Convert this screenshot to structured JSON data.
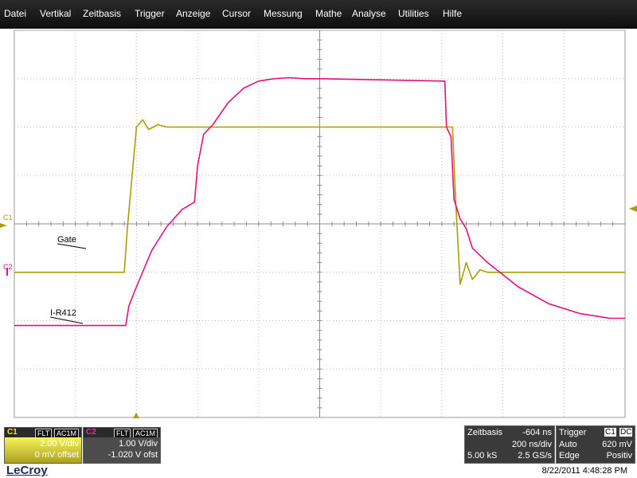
{
  "menu": [
    "Datei",
    "Vertikal",
    "Zeitbasis",
    "Trigger",
    "Anzeige",
    "Cursor",
    "Messung",
    "Mathe",
    "Analyse",
    "Utilities",
    "Hilfe"
  ],
  "colors": {
    "ch1": "#a8a000",
    "ch2": "#e60f7a",
    "grid": "#bfbfbf",
    "menubar": "#1a1a1a"
  },
  "plot": {
    "c1_marker": "C1",
    "c2_marker": "C2",
    "trace_labels": {
      "gate": "Gate",
      "current": "I-R412"
    }
  },
  "channels": {
    "c1": {
      "name": "C1",
      "coupling1": "FLT",
      "coupling2": "AC1M",
      "vdiv": "2.00 V/div",
      "offset": "0 mV offset"
    },
    "c2": {
      "name": "C2",
      "coupling1": "FLT",
      "coupling2": "AC1M",
      "vdiv": "1.00 V/div",
      "offset": "-1.020 V ofst"
    }
  },
  "timebase": {
    "label": "Zeitbasis",
    "delay": "-604 ns",
    "tdiv": "200 ns/div",
    "samples": "5.00 kS",
    "rate": "2.5 GS/s"
  },
  "trigger": {
    "label": "Trigger",
    "source": "C1",
    "coupling": "DC",
    "mode": "Auto",
    "level": "620 mV",
    "type": "Edge",
    "slope": "Positiv"
  },
  "brand": "LeCroy",
  "datetime": "8/22/2011 4:48:28 PM",
  "chart_data": {
    "type": "line",
    "series": [
      {
        "name": "Gate",
        "x": [
          -2.0,
          -1.28,
          -1.26,
          -1.2,
          -1.16,
          -1.12,
          -1.06,
          -1.0,
          0.0,
          0.87,
          0.89,
          0.92,
          0.96,
          1.0,
          1.05,
          1.1,
          1.25,
          1.5,
          2.0
        ],
        "y": [
          -1.0,
          -1.0,
          -0.1,
          2.0,
          2.15,
          1.95,
          2.05,
          2.0,
          2.0,
          2.0,
          0.5,
          -1.25,
          -0.8,
          -1.15,
          -0.95,
          -1.0,
          -1.0,
          -1.0,
          -1.0
        ]
      },
      {
        "name": "I-R412",
        "x": [
          -2.0,
          -1.27,
          -1.25,
          -1.2,
          -1.1,
          -1.0,
          -0.9,
          -0.82,
          -0.8,
          -0.76,
          -0.7,
          -0.6,
          -0.5,
          -0.4,
          -0.3,
          -0.2,
          -0.1,
          0.0,
          0.82,
          0.83,
          0.86,
          0.88,
          0.92,
          0.96,
          1.0,
          1.1,
          1.2,
          1.3,
          1.5,
          1.7,
          1.9,
          2.0
        ],
        "y": [
          -2.1,
          -2.1,
          -1.7,
          -1.3,
          -0.55,
          -0.05,
          0.3,
          0.45,
          1.2,
          1.85,
          2.05,
          2.5,
          2.8,
          2.95,
          3.0,
          3.02,
          3.0,
          3.0,
          2.95,
          2.0,
          1.8,
          0.5,
          0.1,
          -0.1,
          -0.5,
          -0.8,
          -1.05,
          -1.3,
          -1.65,
          -1.85,
          -1.95,
          -1.95
        ]
      }
    ],
    "xlim": [
      -2,
      2
    ],
    "ylim": [
      -4,
      4
    ],
    "x_units": "µs",
    "y_units": "div",
    "grid": true
  }
}
